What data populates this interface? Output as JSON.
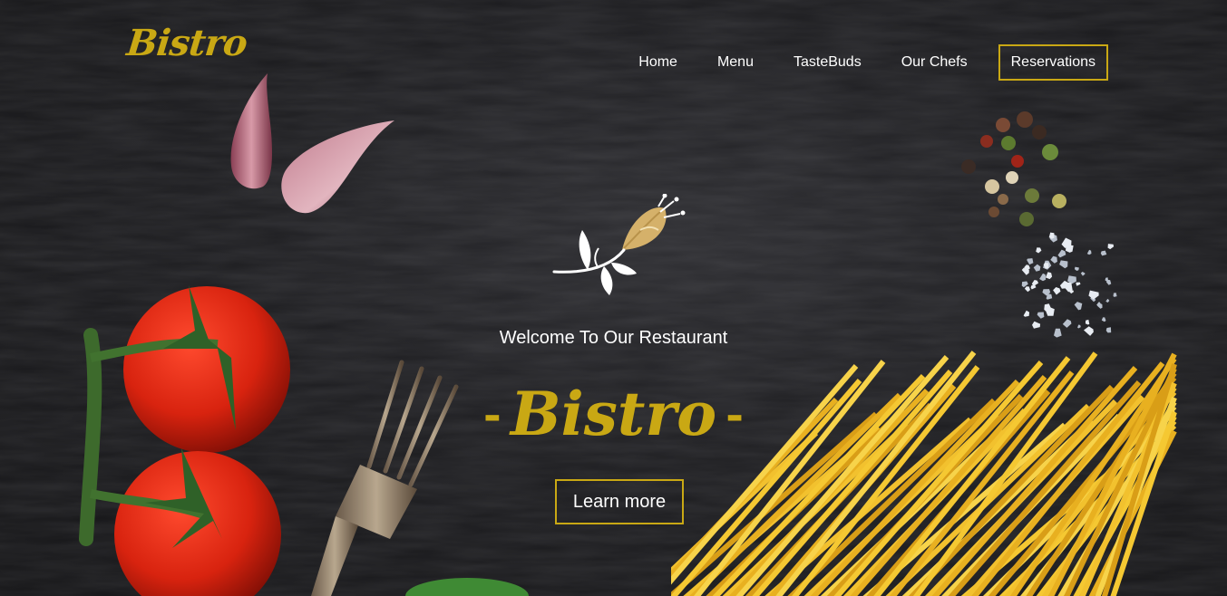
{
  "brand": {
    "name": "Bistro"
  },
  "nav": {
    "items": [
      {
        "label": "Home"
      },
      {
        "label": "Menu"
      },
      {
        "label": "TasteBuds"
      },
      {
        "label": "Our Chefs"
      },
      {
        "label": "Reservations"
      }
    ]
  },
  "hero": {
    "welcome": "Welcome To Our Restaurant",
    "title": "Bistro",
    "dash_left": "-",
    "dash_right": "-",
    "cta": "Learn more"
  },
  "colors": {
    "accent": "#c9a814",
    "background": "#1c1c1e",
    "text": "#ffffff"
  },
  "icons": [
    "leaf-emblem-icon"
  ]
}
